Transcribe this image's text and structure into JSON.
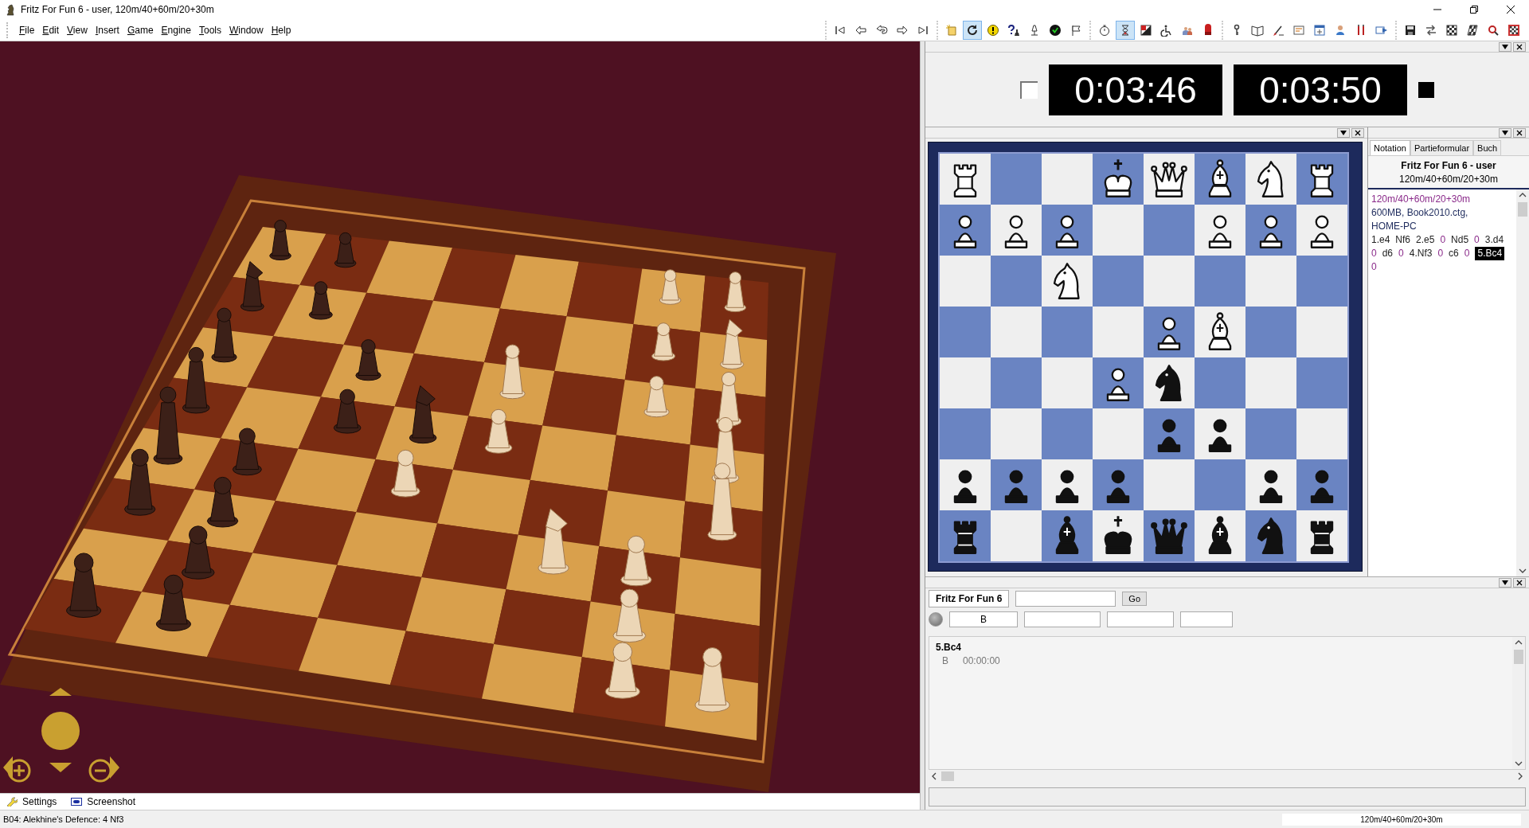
{
  "window": {
    "title": "Fritz For Fun 6 - user, 120m/40+60m/20+30m"
  },
  "menu": [
    "File",
    "Edit",
    "View",
    "Insert",
    "Game",
    "Engine",
    "Tools",
    "Window",
    "Help"
  ],
  "toolbar": [
    [
      {
        "pressed": false
      },
      {
        "pressed": false
      },
      {
        "pressed": false
      },
      {
        "pressed": false
      },
      {
        "pressed": false
      }
    ],
    [
      {
        "pressed": false
      },
      {
        "pressed": true
      },
      {
        "pressed": false
      },
      {
        "pressed": false
      },
      {
        "pressed": false
      },
      {
        "pressed": false
      },
      {
        "pressed": false
      }
    ],
    [
      {
        "pressed": false
      },
      {
        "pressed": true
      },
      {
        "pressed": false
      },
      {
        "pressed": false
      },
      {
        "pressed": false
      },
      {
        "pressed": false
      }
    ],
    [
      {
        "pressed": false
      },
      {
        "pressed": false
      },
      {
        "pressed": false
      },
      {
        "pressed": false
      },
      {
        "pressed": false
      },
      {
        "pressed": false
      },
      {
        "pressed": false
      },
      {
        "pressed": false
      }
    ],
    [
      {
        "pressed": false
      },
      {
        "pressed": false
      },
      {
        "pressed": false
      },
      {
        "pressed": false
      },
      {
        "pressed": false
      },
      {
        "pressed": false
      }
    ]
  ],
  "clocks": [
    {
      "time": "0:03:46",
      "kind": "white"
    },
    {
      "time": "0:03:50",
      "kind": "black"
    }
  ],
  "board": {
    "rows": [
      [
        {
          "kind": "white_rook"
        },
        {
          "kind": "empty"
        },
        {
          "kind": "empty"
        },
        {
          "kind": "white_king"
        },
        {
          "kind": "white_queen"
        },
        {
          "kind": "white_bishop"
        },
        {
          "kind": "white_knight"
        },
        {
          "kind": "white_rook"
        }
      ],
      [
        {
          "kind": "white_pawn"
        },
        {
          "kind": "white_pawn"
        },
        {
          "kind": "white_pawn"
        },
        {
          "kind": "empty"
        },
        {
          "kind": "empty"
        },
        {
          "kind": "white_pawn"
        },
        {
          "kind": "white_pawn"
        },
        {
          "kind": "white_pawn"
        }
      ],
      [
        {
          "kind": "empty"
        },
        {
          "kind": "empty"
        },
        {
          "kind": "white_knight"
        },
        {
          "kind": "empty"
        },
        {
          "kind": "empty"
        },
        {
          "kind": "empty"
        },
        {
          "kind": "empty"
        },
        {
          "kind": "empty"
        }
      ],
      [
        {
          "kind": "empty"
        },
        {
          "kind": "empty"
        },
        {
          "kind": "empty"
        },
        {
          "kind": "empty"
        },
        {
          "kind": "white_pawn"
        },
        {
          "kind": "white_bishop"
        },
        {
          "kind": "empty"
        },
        {
          "kind": "empty"
        }
      ],
      [
        {
          "kind": "empty"
        },
        {
          "kind": "empty"
        },
        {
          "kind": "empty"
        },
        {
          "kind": "white_pawn"
        },
        {
          "kind": "black_knight"
        },
        {
          "kind": "empty"
        },
        {
          "kind": "empty"
        },
        {
          "kind": "empty"
        }
      ],
      [
        {
          "kind": "empty"
        },
        {
          "kind": "empty"
        },
        {
          "kind": "empty"
        },
        {
          "kind": "empty"
        },
        {
          "kind": "black_pawn"
        },
        {
          "kind": "black_pawn"
        },
        {
          "kind": "empty"
        },
        {
          "kind": "empty"
        }
      ],
      [
        {
          "kind": "black_pawn"
        },
        {
          "kind": "black_pawn"
        },
        {
          "kind": "black_pawn"
        },
        {
          "kind": "black_pawn"
        },
        {
          "kind": "empty"
        },
        {
          "kind": "empty"
        },
        {
          "kind": "black_pawn"
        },
        {
          "kind": "black_pawn"
        }
      ],
      [
        {
          "kind": "black_rook"
        },
        {
          "kind": "empty"
        },
        {
          "kind": "black_bishop"
        },
        {
          "kind": "black_king"
        },
        {
          "kind": "black_queen"
        },
        {
          "kind": "black_bishop"
        },
        {
          "kind": "black_knight"
        },
        {
          "kind": "black_rook"
        }
      ]
    ]
  },
  "notation": {
    "tabs": [
      {
        "label": "Notation",
        "selected": true
      },
      {
        "label": "Partieformular",
        "selected": false
      },
      {
        "label": "Buch",
        "selected": false
      }
    ],
    "title": "Fritz For Fun 6 - user",
    "subtitle": "120m/40+60m/20+30m",
    "lines": [
      {
        "text": "120m/40+60m/20+30m",
        "kind": "time_control"
      },
      {
        "text": "600MB, Book2010.ctg,",
        "kind": "info"
      },
      {
        "text": "HOME-PC",
        "kind": "info"
      }
    ],
    "moves": [
      {
        "text": "1.e4",
        "kind": "move",
        "selected": false
      },
      {
        "text": "Nf6",
        "kind": "move",
        "selected": false
      },
      {
        "text": "2.e5",
        "kind": "move",
        "selected": false
      },
      {
        "text": "0",
        "kind": "time",
        "selected": false
      },
      {
        "text": "Nd5",
        "kind": "move",
        "selected": false
      },
      {
        "text": "0",
        "kind": "time",
        "selected": false
      },
      {
        "text": "3.d4",
        "kind": "move",
        "selected": false
      },
      {
        "text": "0",
        "kind": "time",
        "selected": false
      },
      {
        "text": "d6",
        "kind": "move",
        "selected": false
      },
      {
        "text": "0",
        "kind": "time",
        "selected": false
      },
      {
        "text": "4.Nf3",
        "kind": "move",
        "selected": false
      },
      {
        "text": "0",
        "kind": "time",
        "selected": false
      },
      {
        "text": "c6",
        "kind": "move",
        "selected": false
      },
      {
        "text": "0",
        "kind": "time",
        "selected": false
      },
      {
        "text": "5.Bc4",
        "kind": "move",
        "selected": true
      },
      {
        "text": "0",
        "kind": "time",
        "selected": false
      }
    ]
  },
  "engine": {
    "name": "Fritz For Fun 6",
    "go_button": "Go",
    "info_fields": [
      "B"
    ],
    "output": {
      "move": "5.Bc4",
      "details": [
        "B",
        "00:00:00"
      ]
    }
  },
  "bottom_toolbar": [
    {
      "label": "Settings"
    },
    {
      "label": "Screenshot"
    }
  ],
  "status_bar": {
    "opening": "B04: Alekhine's Defence: 4 Nf3",
    "time_control": "120m/40+60m/20+30m"
  }
}
